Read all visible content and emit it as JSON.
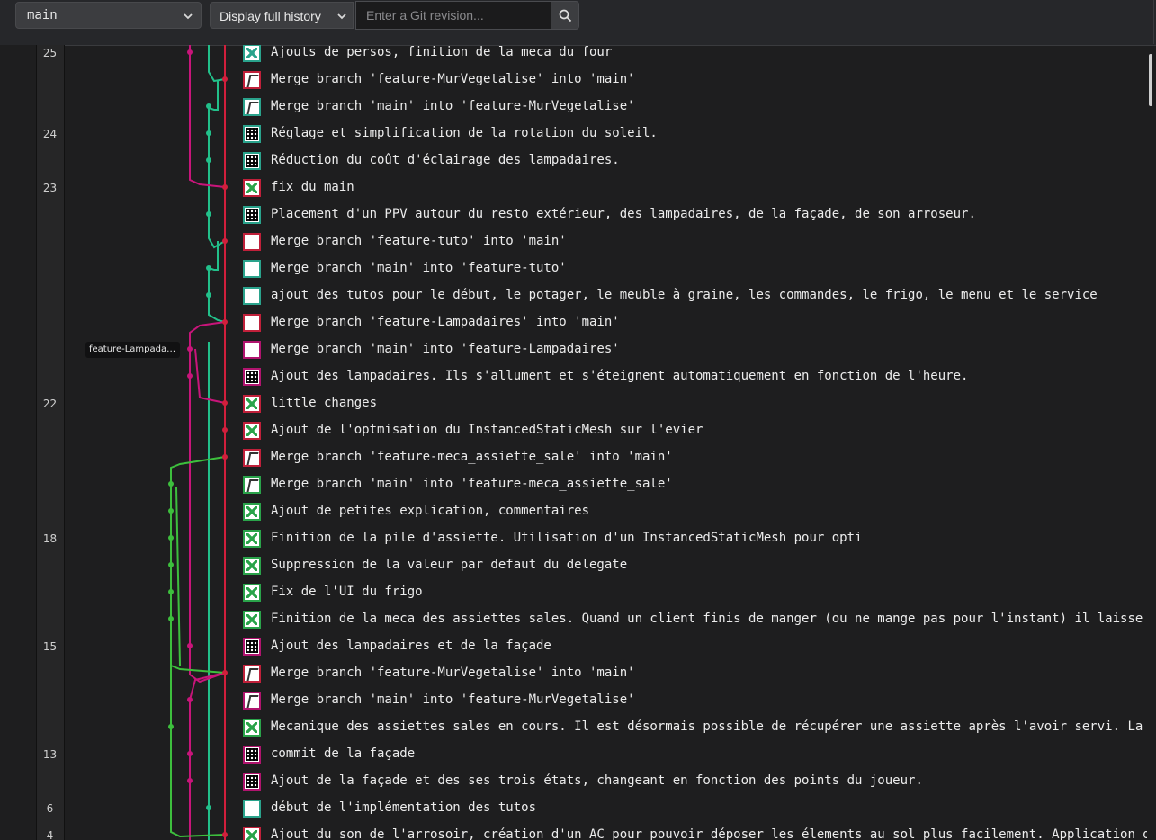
{
  "toolbar": {
    "branch_value": "main",
    "history_label": "Display full history",
    "revision_placeholder": "Enter a Git revision...",
    "revision_value": ""
  },
  "icons": {
    "branch_dropdown": "chevron-down-icon",
    "history_dropdown": "chevron-down-icon",
    "search": "search-icon"
  },
  "branch_tag": {
    "label": "feature-Lampada…"
  },
  "colors": {
    "main_line": "#d21f3c",
    "magenta_line": "#c8157a",
    "teal_line": "#22c08a",
    "green_line": "#3dbf3d"
  },
  "commits": [
    {
      "num": "25",
      "avatar": "av-teal",
      "message": "Ajouts de persos, finition de la meca du four"
    },
    {
      "num": "",
      "avatar": "av-sketch-red",
      "message": "Merge branch 'feature-MurVegetalise' into 'main'"
    },
    {
      "num": "",
      "avatar": "av-sketch-teal",
      "message": "Merge branch 'main' into 'feature-MurVegetalise'"
    },
    {
      "num": "24",
      "avatar": "av-grid av-grid-teal",
      "message": "Réglage et simplification de la rotation du soleil."
    },
    {
      "num": "",
      "avatar": "av-grid av-grid-teal",
      "message": "Réduction du coût d'éclairage des lampadaires."
    },
    {
      "num": "23",
      "avatar": "av-red",
      "message": "fix du main"
    },
    {
      "num": "",
      "avatar": "av-grid av-grid-teal",
      "message": "Placement d'un PPV autour du resto extérieur, des lampadaires, de la façade, de son arroseur."
    },
    {
      "num": "",
      "avatar": "av-pink-red",
      "message": "Merge branch 'feature-tuto' into 'main'"
    },
    {
      "num": "",
      "avatar": "av-pink-teal",
      "message": "Merge branch 'main' into 'feature-tuto'"
    },
    {
      "num": "",
      "avatar": "av-pink-teal",
      "message": "ajout des tutos pour le début, le potager, le meuble à graine, les commandes, le frigo, le menu et le service"
    },
    {
      "num": "",
      "avatar": "av-pink-red",
      "message": "Merge branch 'feature-Lampadaires' into 'main'"
    },
    {
      "num": "",
      "avatar": "av-pink-mag",
      "message": "Merge branch 'main' into 'feature-Lampadaires'"
    },
    {
      "num": "",
      "avatar": "av-grid av-grid-mag",
      "message": "Ajout des lampadaires. Ils s'allument et s'éteignent automatiquement en fonction de l'heure."
    },
    {
      "num": "22",
      "avatar": "av-red",
      "message": "little changes"
    },
    {
      "num": "",
      "avatar": "av-red",
      "message": "Ajout de l'optmisation du InstancedStaticMesh sur l'evier"
    },
    {
      "num": "",
      "avatar": "av-sketch-red",
      "message": "Merge branch 'feature-meca_assiette_sale' into 'main'"
    },
    {
      "num": "",
      "avatar": "av-sketch-green",
      "message": "Merge branch 'main' into 'feature-meca_assiette_sale'"
    },
    {
      "num": "",
      "avatar": "av-green",
      "message": "Ajout de petites explication, commentaires"
    },
    {
      "num": "18",
      "avatar": "av-green",
      "message": "Finition de la pile d'assiette. Utilisation d'un InstancedStaticMesh pour opti"
    },
    {
      "num": "",
      "avatar": "av-green",
      "message": "Suppression de la valeur par defaut du delegate"
    },
    {
      "num": "",
      "avatar": "av-green",
      "message": "Fix de l'UI du frigo"
    },
    {
      "num": "",
      "avatar": "av-green",
      "message": "Finition de la meca des assiettes sales. Quand un client finis de manger (ou ne mange pas pour l'instant) il laisse u"
    },
    {
      "num": "15",
      "avatar": "av-grid av-grid-mag",
      "message": "Ajout des lampadaires et de la façade"
    },
    {
      "num": "",
      "avatar": "av-sketch-red",
      "message": "Merge branch 'feature-MurVegetalise' into 'main'"
    },
    {
      "num": "",
      "avatar": "av-sketch-mag",
      "message": "Merge branch 'main' into 'feature-MurVegetalise'"
    },
    {
      "num": "",
      "avatar": "av-green",
      "message": "Mecanique des assiettes sales en cours. Il est désormais possible de récupérer une assiette après l'avoir servi. La l"
    },
    {
      "num": "13",
      "avatar": "av-grid av-grid-mag",
      "message": "commit de la façade"
    },
    {
      "num": "",
      "avatar": "av-grid av-grid-mag",
      "message": "Ajout de la façade et des ses trois états, changeant en fonction des points du joueur."
    },
    {
      "num": "6",
      "avatar": "av-pink-teal",
      "message": "début de l'implémentation des tutos"
    },
    {
      "num": "4",
      "avatar": "av-red",
      "message": "Ajout du son de l'arrosoir, création d'un AC pour pouvoir déposer les élements au sol plus facilement. Application de"
    }
  ]
}
